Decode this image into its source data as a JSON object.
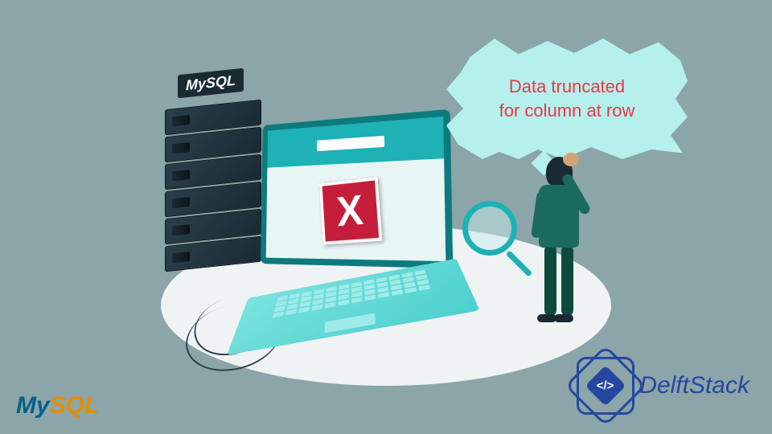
{
  "speech": {
    "line1": "Data truncated",
    "line2": "for column at row"
  },
  "server": {
    "label": "MySQL"
  },
  "error": {
    "symbol": "X"
  },
  "logos": {
    "mysql_my": "My",
    "mysql_sql": "SQL",
    "delftstack": "DelftStack",
    "delft_code": "</>"
  },
  "colors": {
    "background": "#8ba5a9",
    "bubble": "#b5f0ed",
    "error_red": "#c41e3a",
    "speech_text": "#e63946",
    "teal": "#1eb1b5",
    "delft_blue": "#2647a0"
  }
}
